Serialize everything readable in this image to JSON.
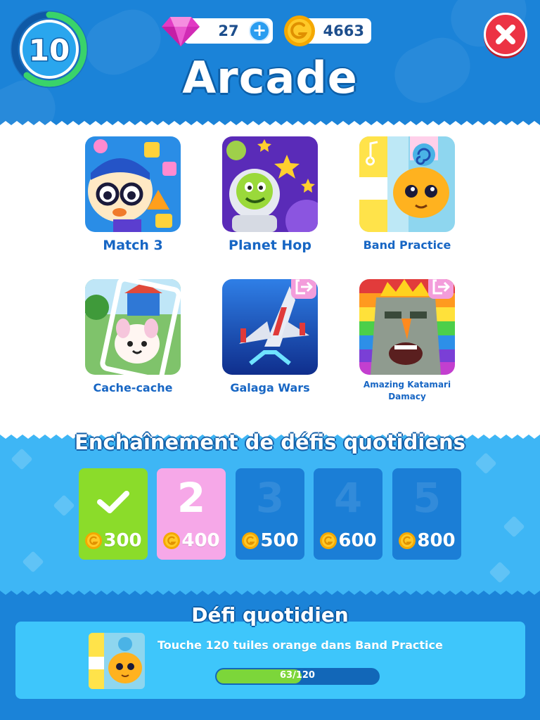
{
  "header": {
    "level": "10",
    "gems": "27",
    "gems_add": "+",
    "coins": "4663",
    "title": "Arcade"
  },
  "games": [
    {
      "label": "Match 3",
      "icon": "match3-thumbnail",
      "external": false
    },
    {
      "label": "Planet Hop",
      "icon": "planet-hop-thumbnail",
      "external": false
    },
    {
      "label": "Band Practice",
      "icon": "band-practice-thumbnail",
      "external": false
    },
    {
      "label": "Cache-cache",
      "icon": "cache-cache-thumbnail",
      "external": false
    },
    {
      "label": "Galaga Wars",
      "icon": "galaga-wars-thumbnail",
      "external": true
    },
    {
      "label": "Amazing Katamari Damacy",
      "icon": "katamari-thumbnail",
      "external": true
    }
  ],
  "streak": {
    "title": "Enchaînement de défis quotidiens",
    "days": [
      {
        "number": "1",
        "reward": "300",
        "state": "completed"
      },
      {
        "number": "2",
        "reward": "400",
        "state": "current"
      },
      {
        "number": "3",
        "reward": "500",
        "state": "locked"
      },
      {
        "number": "4",
        "reward": "600",
        "state": "locked"
      },
      {
        "number": "5",
        "reward": "800",
        "state": "locked"
      }
    ]
  },
  "daily": {
    "title": "Défi quotidien",
    "description": "Touche 120 tuiles orange dans Band Practice",
    "progress_text": "63/120",
    "progress_fraction": 0.525
  },
  "colors": {
    "header_blue": "#1b83d8",
    "streak_blue": "#3eb6f5",
    "completed_green": "#8bdc2a",
    "current_pink": "#f6a8e8",
    "close_red": "#ec3344",
    "label_blue": "#1766c4"
  }
}
